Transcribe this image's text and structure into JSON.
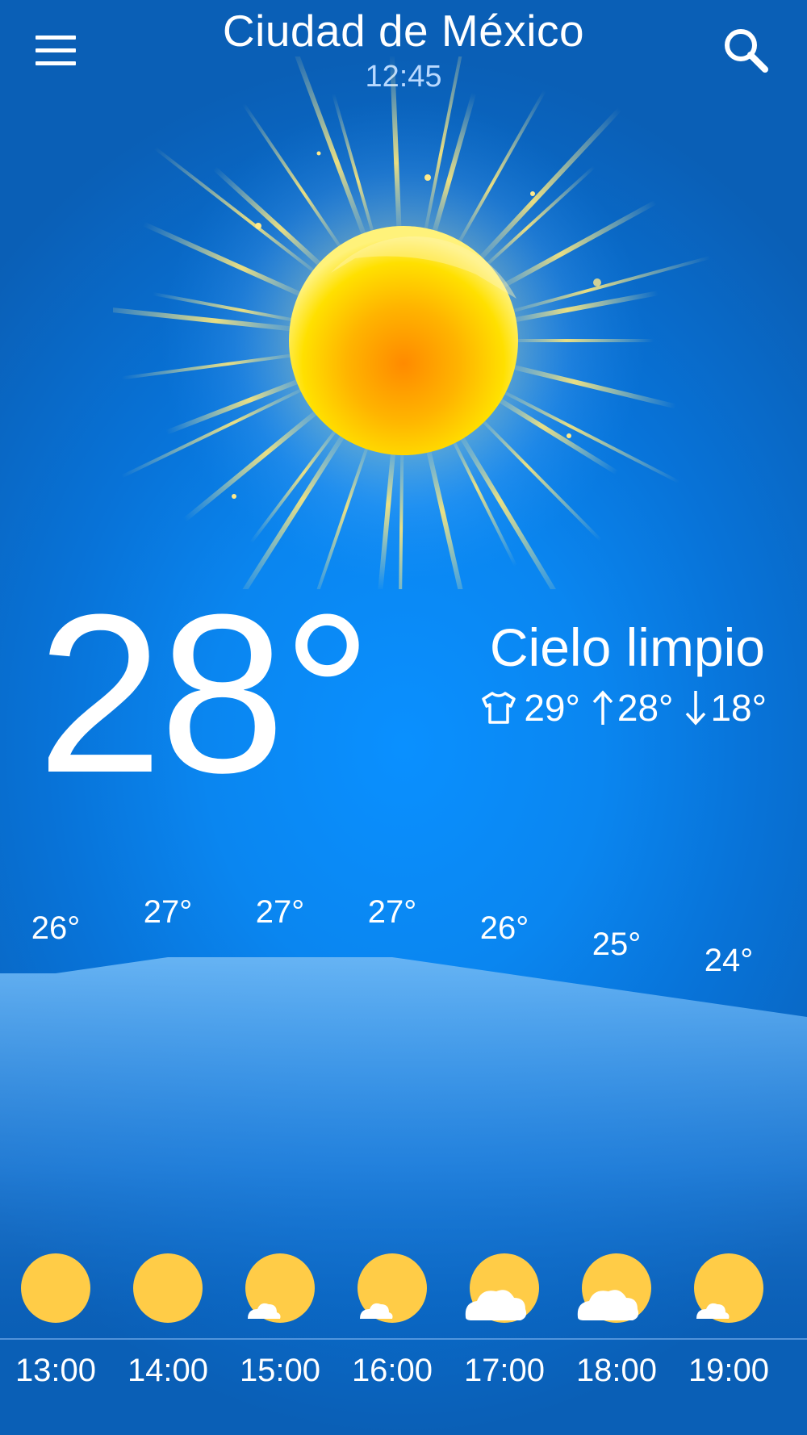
{
  "header": {
    "city": "Ciudad de México",
    "time": "12:45",
    "menu_icon": "hamburger-menu-icon",
    "search_icon": "search-icon"
  },
  "current": {
    "temperature": "28°",
    "condition": "Cielo limpio",
    "feels_like": "29°",
    "high": "28°",
    "low": "18°",
    "weather_icon": "sun-icon"
  },
  "colors": {
    "accent_sun": "#ffd24a",
    "background": "#0a86f0"
  },
  "hourly": [
    {
      "time": "13:00",
      "temp": "26°",
      "icon": "sun-icon",
      "value": 26
    },
    {
      "time": "14:00",
      "temp": "27°",
      "icon": "sun-icon",
      "value": 27
    },
    {
      "time": "15:00",
      "temp": "27°",
      "icon": "sun-small-cloud-icon",
      "value": 27
    },
    {
      "time": "16:00",
      "temp": "27°",
      "icon": "sun-small-cloud-icon",
      "value": 27
    },
    {
      "time": "17:00",
      "temp": "26°",
      "icon": "sun-cloud-icon",
      "value": 26
    },
    {
      "time": "18:00",
      "temp": "25°",
      "icon": "sun-cloud-icon",
      "value": 25
    },
    {
      "time": "19:00",
      "temp": "24°",
      "icon": "sun-small-cloud-icon",
      "value": 24
    }
  ]
}
